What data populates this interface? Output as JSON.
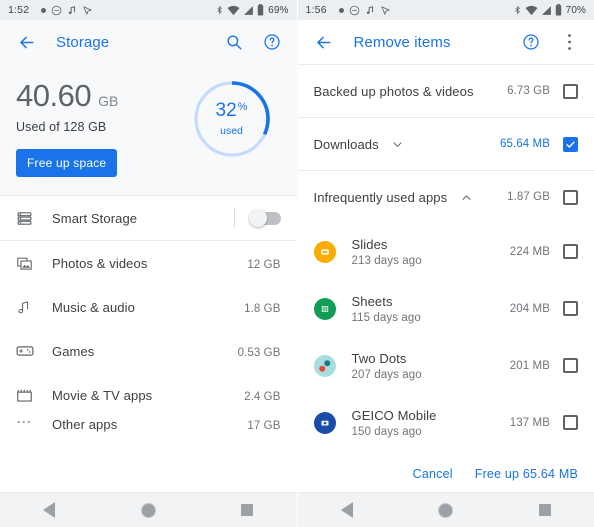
{
  "left": {
    "status": {
      "time": "1:52",
      "battery": "69%",
      "left_icons": [
        "dot-icon",
        "do-not-disturb-icon",
        "music-note-icon",
        "location-icon"
      ],
      "right_icons": [
        "bluetooth-icon",
        "wifi-icon",
        "signal-icon",
        "battery-icon"
      ]
    },
    "appbar": {
      "back_icon": "back-arrow-icon",
      "title": "Storage",
      "search_icon": "search-icon",
      "help_icon": "help-icon"
    },
    "summary": {
      "used_value": "40.60",
      "used_unit": "GB",
      "subtitle": "Used of 128 GB",
      "button_label": "Free up space",
      "donut_percent": "32",
      "donut_percent_sign": "%",
      "donut_caption": "used",
      "donut_fill_ratio": 0.32,
      "accent_color": "#1a73e8",
      "track_color": "#c6dafc"
    },
    "smart_storage": {
      "label": "Smart Storage",
      "icon": "storage-list-icon",
      "toggle_on": false
    },
    "categories": [
      {
        "icon": "photos-icon",
        "name": "Photos & videos",
        "size": "12 GB",
        "fill": 9
      },
      {
        "icon": "music-note-icon",
        "name": "Music & audio",
        "size": "1.8 GB",
        "fill": 1.4
      },
      {
        "icon": "games-controller-icon",
        "name": "Games",
        "size": "0.53 GB",
        "fill": 0.4
      },
      {
        "icon": "movie-clapper-icon",
        "name": "Movie & TV apps",
        "size": "2.4 GB",
        "fill": 1.8
      },
      {
        "icon": "more-dots-icon",
        "name": "Other apps",
        "size": "17 GB",
        "fill": 13
      }
    ],
    "navbar": [
      "back-nav-icon",
      "home-nav-icon",
      "recents-nav-icon"
    ]
  },
  "right": {
    "status": {
      "time": "1:56",
      "battery": "70%",
      "left_icons": [
        "dot-icon",
        "do-not-disturb-icon",
        "music-note-icon",
        "location-icon"
      ],
      "right_icons": [
        "bluetooth-icon",
        "wifi-icon",
        "signal-icon",
        "battery-icon"
      ]
    },
    "appbar": {
      "back_icon": "back-arrow-icon",
      "title": "Remove items",
      "help_icon": "help-icon",
      "overflow_icon": "more-vertical-icon"
    },
    "groups": [
      {
        "label": "Backed up photos & videos",
        "size": "6.73 GB",
        "checked": false,
        "chevron": null,
        "highlight": false
      },
      {
        "label": "Downloads",
        "size": "65.64 MB",
        "checked": true,
        "chevron": "chevron-down-icon",
        "highlight": true
      },
      {
        "label": "Infrequently used apps",
        "size": "1.87 GB",
        "checked": false,
        "chevron": "chevron-up-icon",
        "highlight": false
      }
    ],
    "apps": [
      {
        "icon": "slides-app-icon",
        "color": "#F9AB00",
        "name": "Slides",
        "age": "213 days ago",
        "size": "224 MB",
        "checked": false
      },
      {
        "icon": "sheets-app-icon",
        "color": "#0F9D58",
        "name": "Sheets",
        "age": "115 days ago",
        "size": "204 MB",
        "checked": false
      },
      {
        "icon": "two-dots-app-icon",
        "color": "#A8DEE0",
        "name": "Two Dots",
        "age": "207 days ago",
        "size": "201 MB",
        "checked": false
      },
      {
        "icon": "geico-app-icon",
        "color": "#1A4CA8",
        "name": "GEICO Mobile",
        "age": "150 days ago",
        "size": "137 MB",
        "checked": false
      }
    ],
    "actions": {
      "cancel_label": "Cancel",
      "confirm_label": "Free up 65.64 MB"
    },
    "navbar": [
      "back-nav-icon",
      "home-nav-icon",
      "recents-nav-icon"
    ]
  }
}
